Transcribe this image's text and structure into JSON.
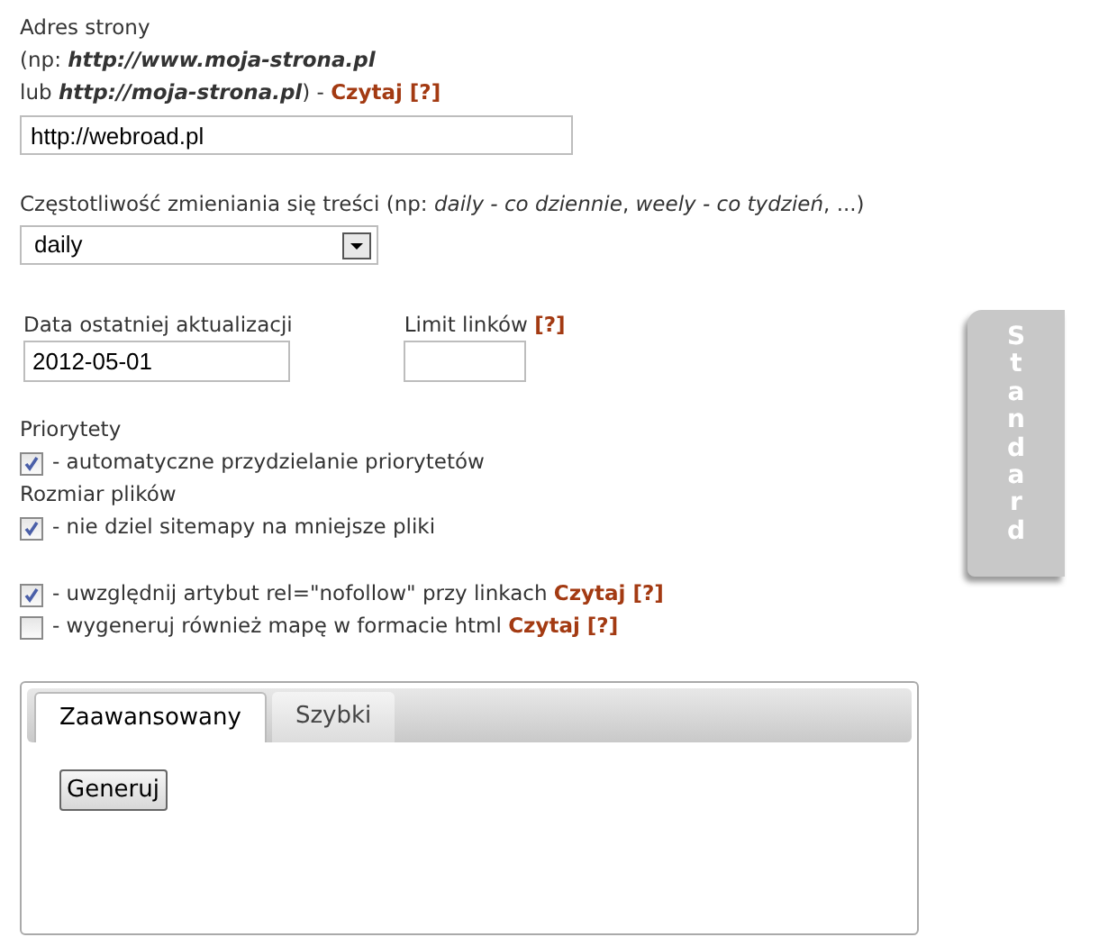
{
  "address": {
    "label_lines": [
      "Adres strony",
      "(np: **http://www.moja-strona.pl**",
      "lub **http://moja-strona.pl**) - "
    ],
    "link": "Czytaj [?]",
    "value": "http://webroad.pl"
  },
  "frequency": {
    "label": "Częstotliwość zmieniania się treści (np: *daily - co dziennie*, *weely - co tydzień*, ...)",
    "value": "daily"
  },
  "last_update": {
    "label": "Data ostatniej aktualizacji",
    "value": "2012-05-01"
  },
  "link_limit": {
    "label": "Limit linków ",
    "link": "[?]"
  },
  "options": [
    {
      "kind": "heading",
      "text": "Priorytety"
    },
    {
      "kind": "checkbox",
      "text": "- automatyczne przydzielanie priorytetów",
      "checked": true
    },
    {
      "kind": "heading",
      "text": "Rozmiar plików"
    },
    {
      "kind": "checkbox",
      "text": "- nie dziel sitemapy na mniejsze pliki",
      "checked": true
    },
    {
      "kind": "spacer"
    },
    {
      "kind": "checkbox",
      "text": "- uwzględnij artybut rel=\"nofollow\" przy linkach ",
      "link": "Czytaj [?]",
      "checked": true
    },
    {
      "kind": "checkbox",
      "text": "- wygeneruj również mapę w formacie html ",
      "link": "Czytaj [?]",
      "checked": false
    }
  ],
  "tabs": [
    {
      "label": "Zaawansowany",
      "selected": true
    },
    {
      "label": "Szybki",
      "selected": false
    }
  ],
  "generate_button": "Generuj",
  "side_tab": "Standard"
}
